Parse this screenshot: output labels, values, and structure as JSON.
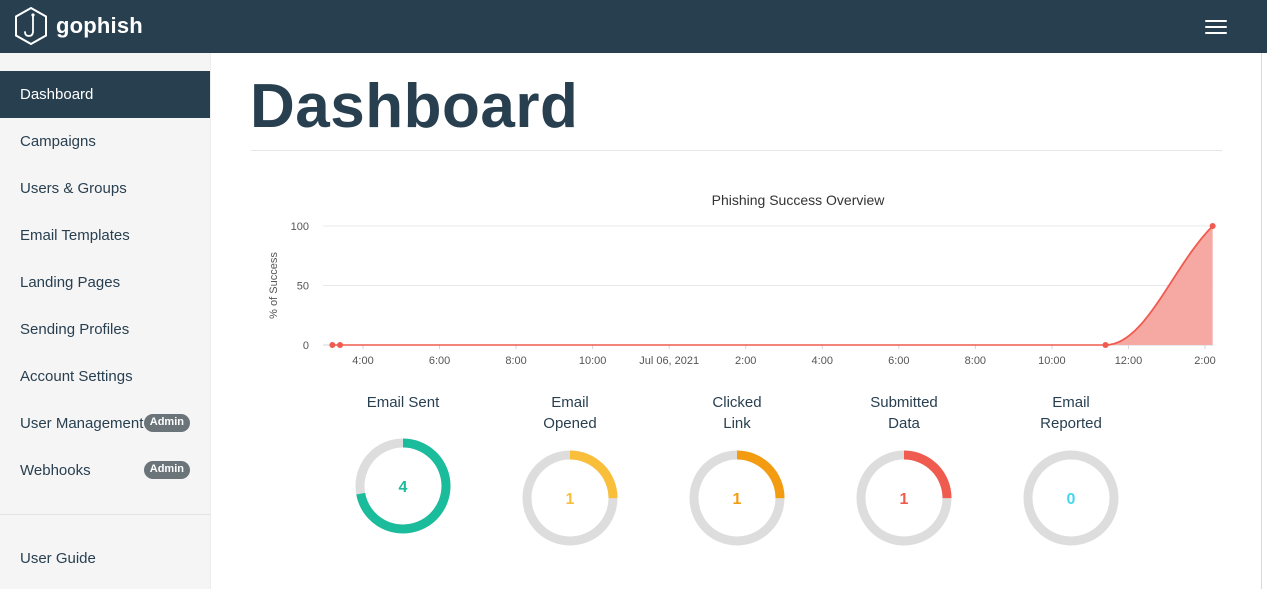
{
  "brand": {
    "name": "gophish"
  },
  "sidebar": {
    "items": [
      {
        "label": "Dashboard",
        "active": true
      },
      {
        "label": "Campaigns"
      },
      {
        "label": "Users & Groups"
      },
      {
        "label": "Email Templates"
      },
      {
        "label": "Landing Pages"
      },
      {
        "label": "Sending Profiles"
      },
      {
        "label": "Account Settings"
      },
      {
        "label": "User Management",
        "badge": "Admin"
      },
      {
        "label": "Webhooks",
        "badge": "Admin"
      }
    ],
    "footer_items": [
      {
        "label": "User Guide"
      }
    ]
  },
  "main": {
    "title": "Dashboard"
  },
  "chart_data": {
    "type": "area",
    "title": "Phishing Success Overview",
    "ylabel": "% of Success",
    "xlabel": "",
    "ylim": [
      0,
      100
    ],
    "yticks": [
      0,
      50,
      100
    ],
    "xticks": [
      "4:00",
      "6:00",
      "8:00",
      "10:00",
      "Jul 06, 2021",
      "2:00",
      "4:00",
      "6:00",
      "8:00",
      "10:00",
      "12:00",
      "2:00"
    ],
    "x_hours": [
      3.2,
      3.4,
      11.4,
      14.2
    ],
    "y": [
      0,
      0,
      0,
      100
    ],
    "color": "#f05b4f",
    "fill": "#f6a9a3"
  },
  "stats": [
    {
      "label_lines": [
        "Email Sent"
      ],
      "value": "4",
      "fraction": 1.0,
      "color": "#1abc9c"
    },
    {
      "label_lines": [
        "Email",
        "Opened"
      ],
      "value": "1",
      "fraction": 0.25,
      "color": "#f9bf3b"
    },
    {
      "label_lines": [
        "Clicked",
        "Link"
      ],
      "value": "1",
      "fraction": 0.25,
      "color": "#f39c12"
    },
    {
      "label_lines": [
        "Submitted",
        "Data"
      ],
      "value": "1",
      "fraction": 0.25,
      "color": "#f05b4f"
    },
    {
      "label_lines": [
        "Email",
        "Reported"
      ],
      "value": "0",
      "fraction": 0.0,
      "color": "#45d6ef"
    }
  ],
  "colors": {
    "navbar": "#283f50",
    "sidebar": "#f5f5f5",
    "track": "#dddddd"
  }
}
